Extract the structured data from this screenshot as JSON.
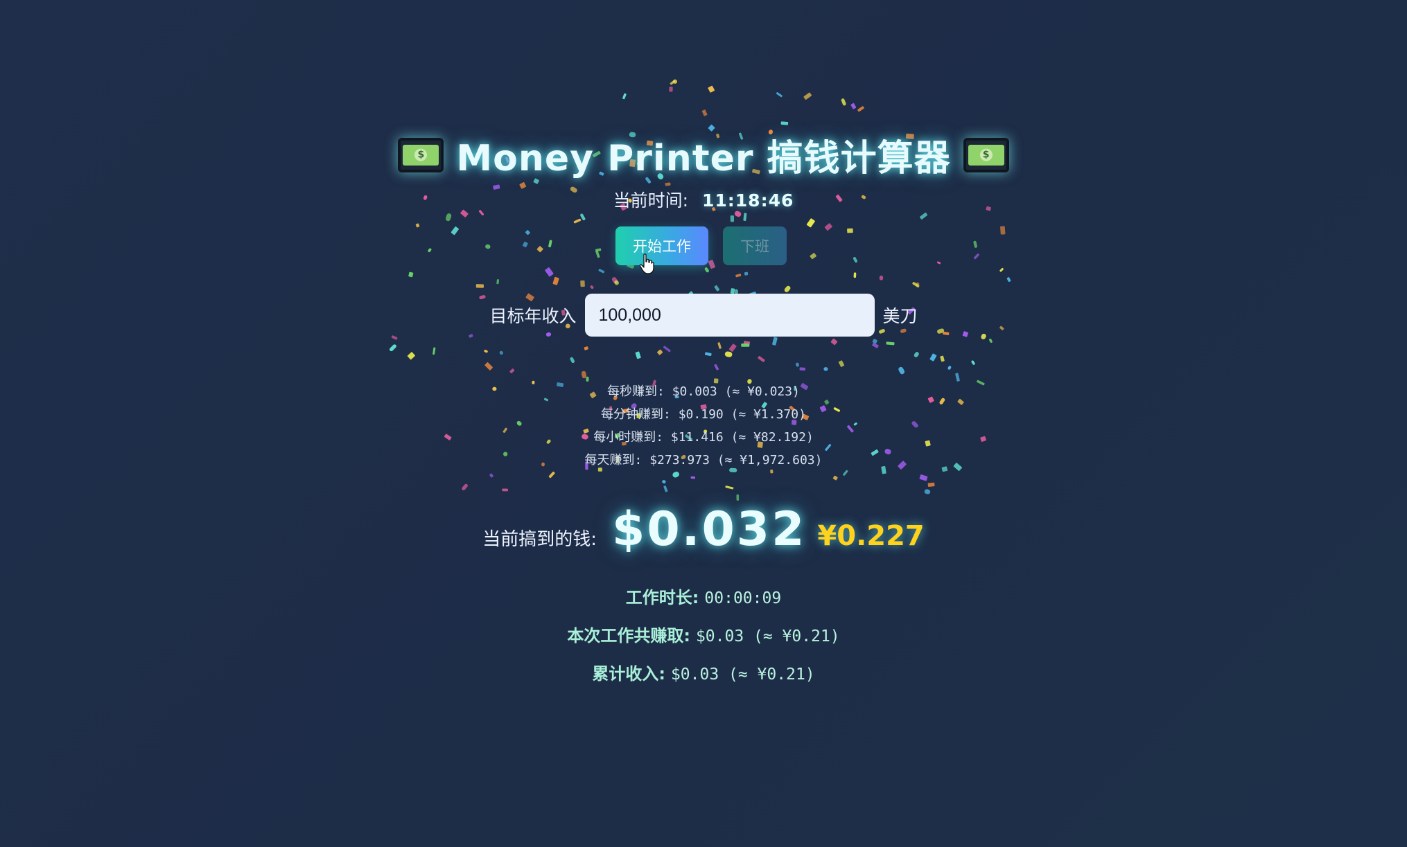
{
  "header": {
    "title": "Money Printer 搞钱计算器",
    "left_icon": "money-bill-icon",
    "right_icon": "money-bill-icon"
  },
  "clock": {
    "label": "当前时间:",
    "value": "11:18:46"
  },
  "controls": {
    "start_label": "开始工作",
    "stop_label": "下班"
  },
  "income": {
    "label": "目标年收入",
    "value": "100,000",
    "unit": "美刀"
  },
  "rates": [
    "每秒赚到: $0.003 (≈ ¥0.023)",
    "每分钟赚到: $0.190 (≈ ¥1.370)",
    "每小时赚到: $11.416 (≈ ¥82.192)",
    "每天赚到: $273.973 (≈ ¥1,972.603)"
  ],
  "earned": {
    "label": "当前搞到的钱:",
    "usd": "$0.032",
    "cny": "¥0.227"
  },
  "stats": {
    "duration_label": "工作时长:",
    "duration_value": "00:00:09",
    "session_label": "本次工作共赚取:",
    "session_value": "$0.03 (≈ ¥0.21)",
    "total_label": "累计收入:",
    "total_value": "$0.03 (≈ ¥0.21)"
  },
  "colors": {
    "background": "#1e2d48",
    "accent_cyan": "#5fe6ec",
    "accent_yellow": "#ffd21c",
    "stat_green": "#a9f0d8"
  }
}
